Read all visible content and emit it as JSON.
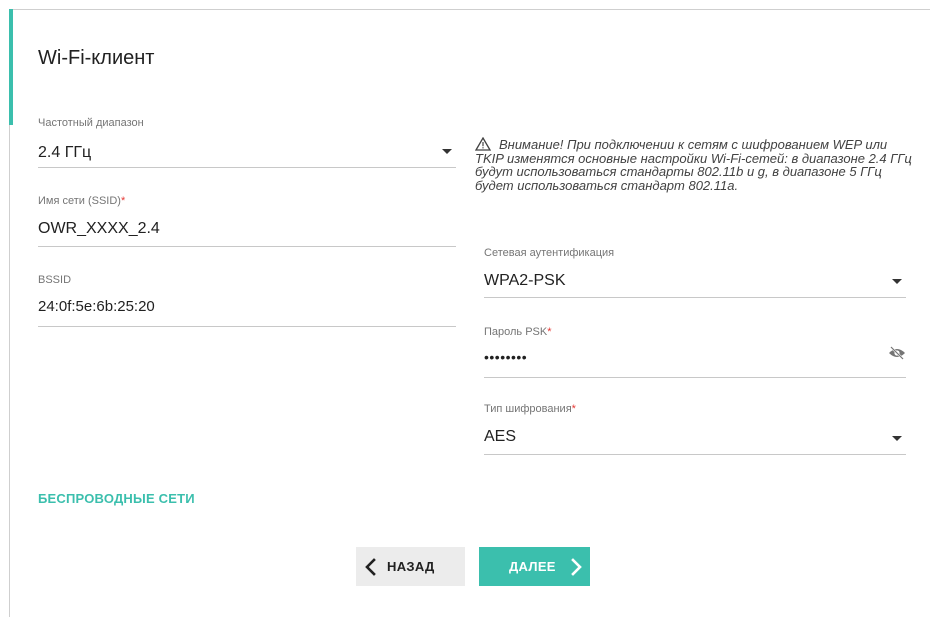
{
  "card": {
    "title": "Wi-Fi-клиент"
  },
  "fields": {
    "band": {
      "label": "Частотный диапазон",
      "value": "2.4 ГГц"
    },
    "ssid": {
      "label": "Имя сети (SSID)",
      "required_mark": "*",
      "value": "OWR_XXXX_2.4"
    },
    "bssid": {
      "label": "BSSID",
      "value": "24:0f:5e:6b:25:20"
    },
    "auth": {
      "label": "Сетевая аутентификация",
      "value": "WPA2-PSK"
    },
    "psk": {
      "label": "Пароль PSK",
      "required_mark": "*",
      "value": "••••••••"
    },
    "encryption": {
      "label": "Тип шифрования",
      "required_mark": "*",
      "value": "AES"
    }
  },
  "warning": {
    "text": "Внимание! При подключении к сетям с шифрованием WEP или TKIP изменятся основные настройки Wi-Fi-сетей: в диапазоне 2.4 ГГц будут использоваться стандарты 802.11b и g, в диапазоне 5 ГГц будет использоваться стандарт 802.11a."
  },
  "links": {
    "wireless_networks": "БЕСПРОВОДНЫЕ СЕТИ"
  },
  "buttons": {
    "back": "НАЗАД",
    "next": "ДАЛЕЕ"
  },
  "icons": {
    "select": "chevron-down-icon",
    "password_visibility": "eye-off-icon",
    "warning": "warning-triangle-icon",
    "back": "chevron-left-icon",
    "next": "chevron-right-icon"
  },
  "colors": {
    "accent": "#3bbfad",
    "required": "#e53935",
    "back_button_bg": "#ececec"
  }
}
